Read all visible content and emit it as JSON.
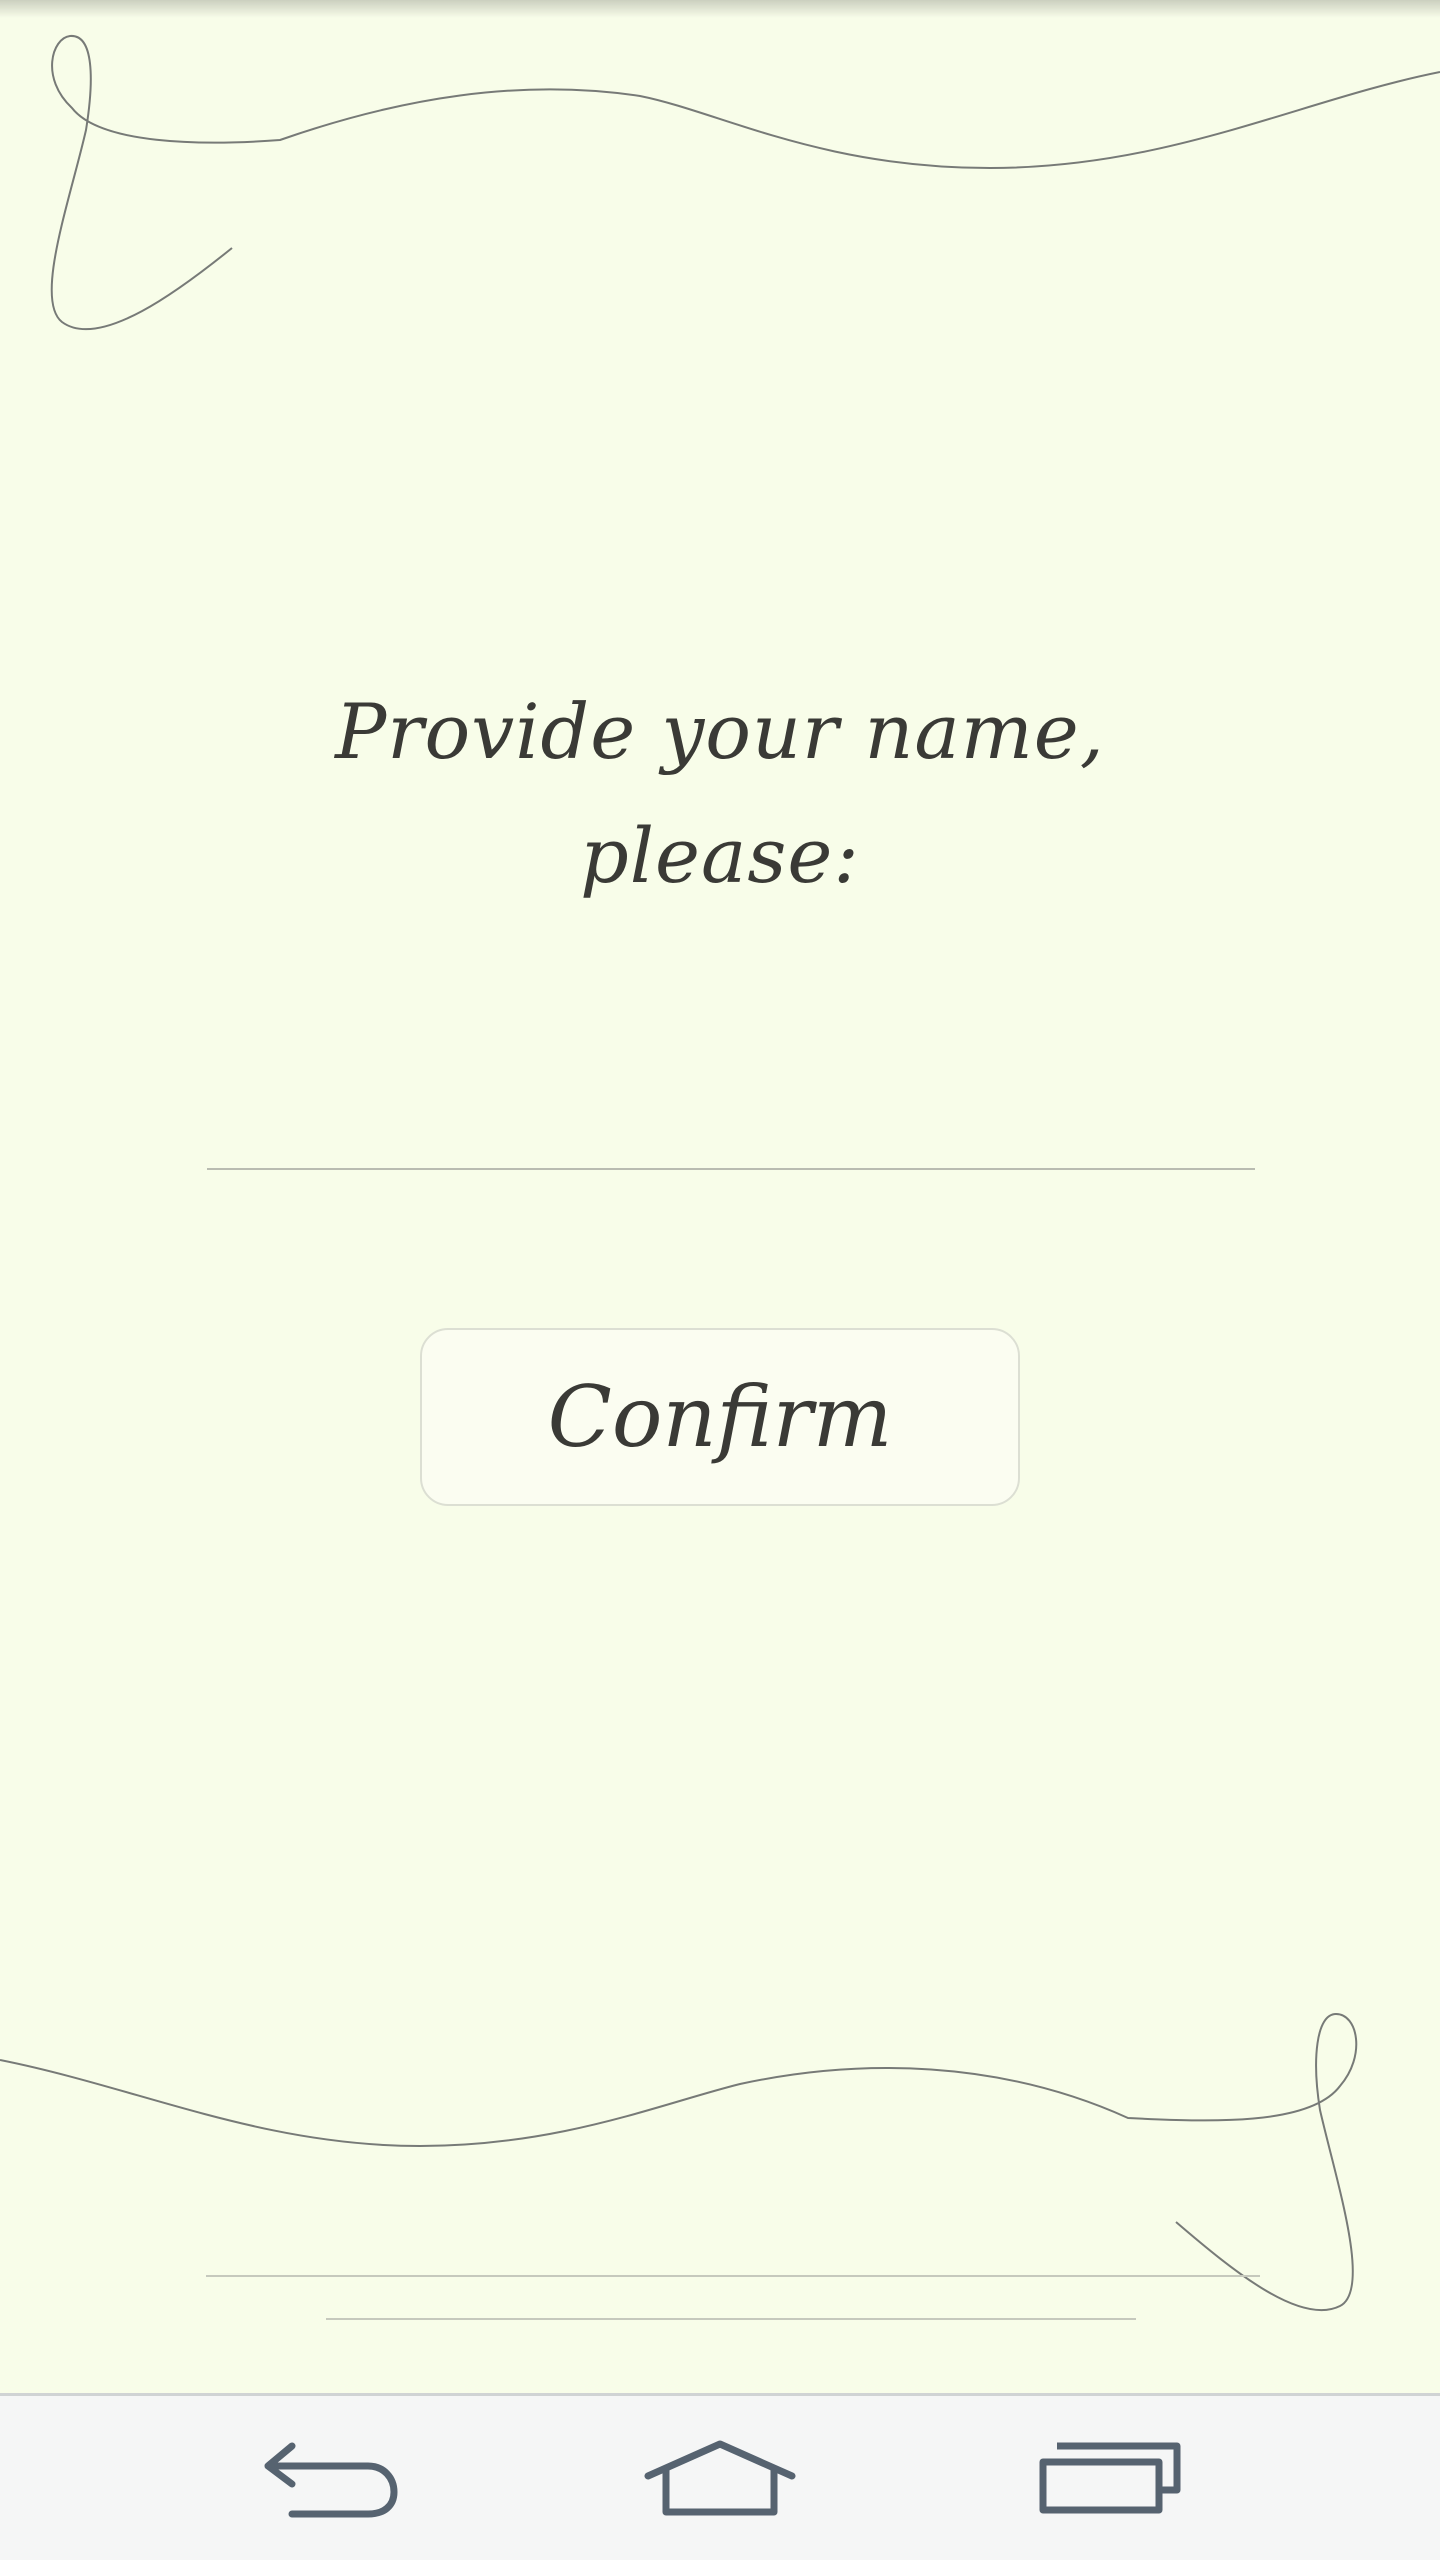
{
  "prompt": {
    "line1": "Provide your name,",
    "line2": "please:"
  },
  "name_input": {
    "value": "",
    "placeholder": ""
  },
  "confirm_button": {
    "label": "Confirm"
  },
  "colors": {
    "background": "#f8fde9",
    "text": "#3a3a36",
    "flourish": "#6e6e6e",
    "navbar": "#f5f6f6",
    "nav_icon": "#566370"
  },
  "navbar": {
    "buttons": [
      {
        "icon": "back-icon"
      },
      {
        "icon": "home-icon"
      },
      {
        "icon": "recent-apps-icon"
      }
    ]
  }
}
